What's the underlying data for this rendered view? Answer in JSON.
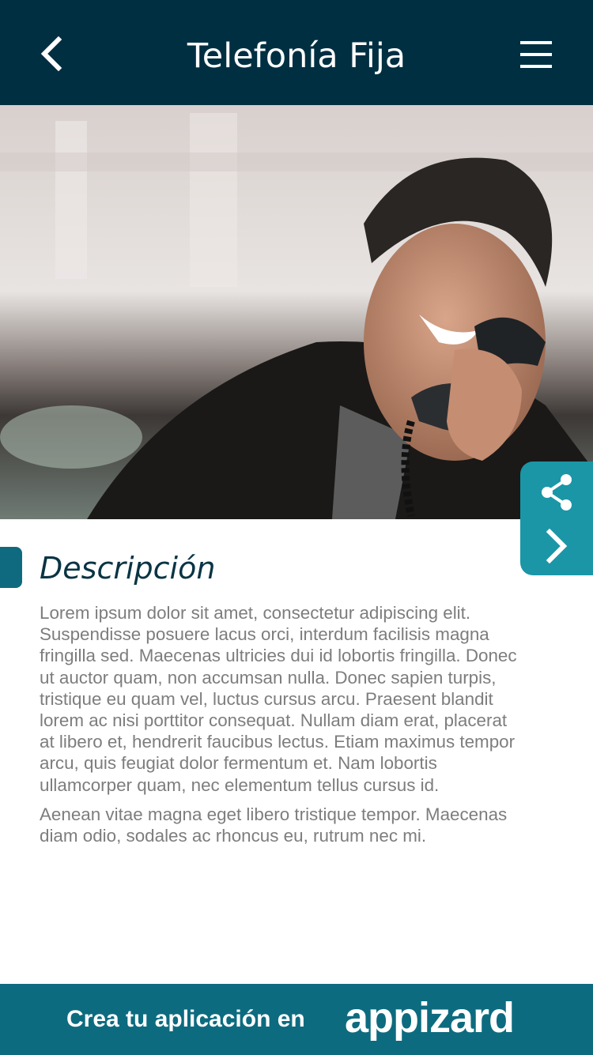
{
  "header": {
    "title": "Telefonía Fija",
    "back_icon": "chevron-left-icon",
    "menu_icon": "hamburger-menu-icon"
  },
  "hero": {
    "image": "man-talking-on-landline-phone-photo"
  },
  "side_actions": {
    "share_icon": "share-icon",
    "next_icon": "chevron-right-icon"
  },
  "description": {
    "heading": "Descripción",
    "paragraphs": [
      "Lorem ipsum dolor sit amet, consectetur adipiscing elit. Suspendisse posuere lacus orci, interdum facilisis magna fringilla sed. Maecenas ultricies dui id lobortis fringilla. Donec ut auctor quam, non accumsan nulla. Donec sapien turpis, tristique eu quam vel, luctus cursus arcu. Praesent blandit lorem ac nisi porttitor consequat. Nullam diam erat, placerat at libero et, hendrerit faucibus lectus. Etiam maximus tempor arcu, quis feugiat dolor fermentum et. Nam lobortis ullamcorper quam, nec elementum tellus cursus id.",
      "Aenean vitae magna eget libero tristique tempor. Maecenas diam odio, sodales ac rhoncus eu, rutrum nec mi."
    ]
  },
  "footer": {
    "text": "Crea tu aplicación en",
    "brand": "appizard"
  },
  "colors": {
    "header_bg": "#002f42",
    "accent": "#1a96a7",
    "footer_bg": "#0d6b7f",
    "heading": "#0a3444",
    "body_text": "#7d7d7d"
  }
}
